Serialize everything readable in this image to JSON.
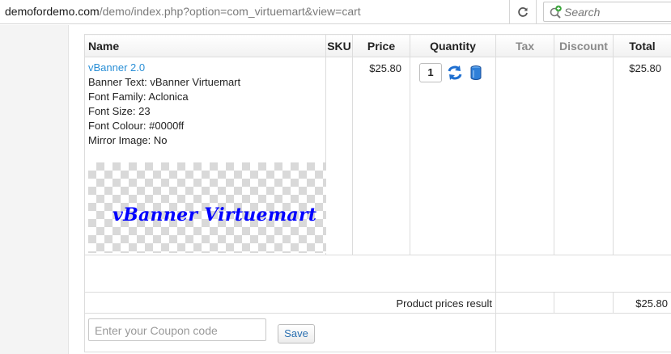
{
  "browser": {
    "url_host": "demofordemo.com",
    "url_path": "/demo/index.php?option=com_virtuemart&view=cart",
    "search_placeholder": "Search"
  },
  "cart": {
    "headers": {
      "name": "Name",
      "sku": "SKU",
      "price": "Price",
      "quantity": "Quantity",
      "tax": "Tax",
      "discount": "Discount",
      "total": "Total"
    },
    "item": {
      "name": "vBanner 2.0",
      "details": [
        "Banner Text: vBanner Virtuemart",
        "Font Family: Aclonica",
        "Font Size: 23",
        "Font Colour: #0000ff",
        "Mirror Image: No"
      ],
      "banner_text": "vBanner Virtuemart",
      "banner_color": "#0000ff",
      "price": "$25.80",
      "quantity": "1",
      "total": "$25.80"
    },
    "summary": {
      "label": "Product prices result",
      "total": "$25.80"
    },
    "coupon": {
      "placeholder": "Enter your Coupon code",
      "save_label": "Save"
    }
  },
  "icons": {
    "refresh": "refresh-icon",
    "search": "search-add-icon",
    "update": "update-quantity-icon",
    "delete": "delete-item-icon"
  },
  "colors": {
    "link": "#2a8fd6",
    "banner_text": "#0000ff"
  }
}
